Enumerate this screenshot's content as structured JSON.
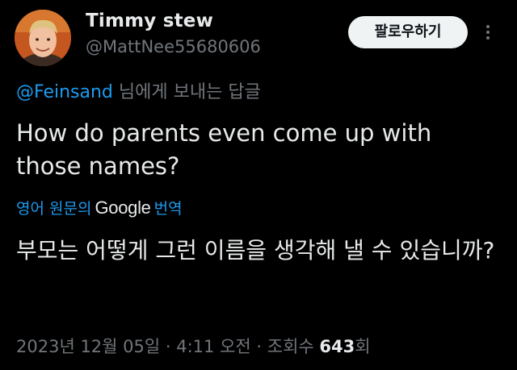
{
  "author": {
    "display_name": "Timmy stew",
    "handle": "@MattNee55680606"
  },
  "follow_button": {
    "label": "팔로우하기"
  },
  "more_menu": {
    "icon": "more-vertical-icon"
  },
  "reply": {
    "mention": "@Feinsand",
    "suffix": " 님에게 보내는 답글"
  },
  "tweet": {
    "text": "How do parents even come up with those names?"
  },
  "translation": {
    "prefix": "영어 원문의",
    "provider": "Google",
    "suffix": "번역",
    "text": "부모는 어떻게 그런 이름을 생각해 낼 수 있습니까?"
  },
  "meta": {
    "date": "2023년 12월 05일",
    "separator": " · ",
    "time": "4:11 오전",
    "views_label": "조회수 ",
    "views_count": "643",
    "views_suffix": "회"
  },
  "colors": {
    "background": "#000000",
    "text_primary": "#e7e9ea",
    "text_secondary": "#71767b",
    "accent": "#1d9bf0",
    "button_bg": "#eff3f4",
    "button_text": "#0f1419"
  }
}
